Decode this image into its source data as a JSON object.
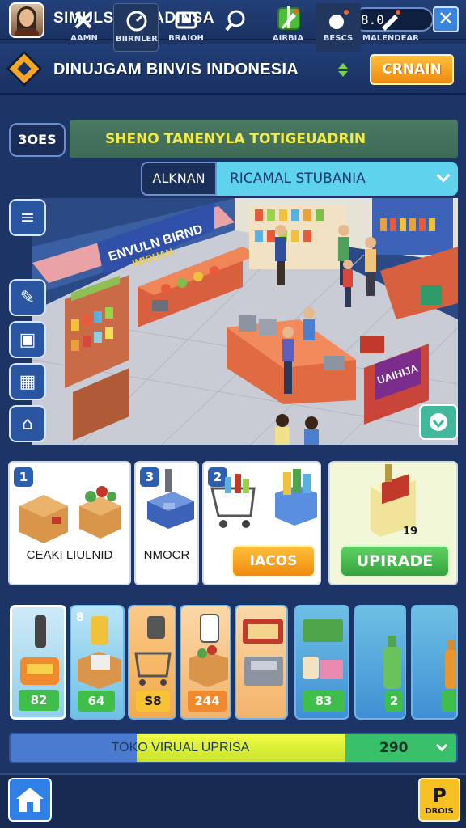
{
  "header": {
    "title": "SIMULSN RUADINSA",
    "currency_label": "8",
    "coins": "8.0"
  },
  "banner": {
    "title": "DINUJGAM BINVIS INDONESIA",
    "button_label": "CRNAIN"
  },
  "filters": {
    "tag": "3OES",
    "select_1": "SHENO TANENYLA TOTIGEUADRIN",
    "select_2_label": "ALKNAN",
    "select_2_value": "RICAMAL STUBANIA"
  },
  "scene": {
    "store_sign": "ENVULN BIRND",
    "store_sign_sub": "IMIOUAN",
    "counter_sign": "UAIHIJA"
  },
  "cards": [
    {
      "badge": "1",
      "label": "CEAKI LIULNID"
    },
    {
      "badge": "3",
      "label": "NMOCR"
    },
    {
      "badge": "2",
      "button": "IACOS"
    },
    {
      "count": "19",
      "button": "UPIRADE"
    }
  ],
  "items": [
    {
      "price": "82",
      "badge": ""
    },
    {
      "price": "64",
      "badge": "8"
    },
    {
      "price": "S8",
      "badge": ""
    },
    {
      "price": "244",
      "badge": ""
    },
    {
      "price": "",
      "badge": ""
    },
    {
      "price": "83",
      "badge": ""
    },
    {
      "price": "2",
      "badge": ""
    },
    {
      "price": "",
      "badge": ""
    }
  ],
  "progress": {
    "label": "TOKO VIRUAL UPRISA",
    "value": "290"
  },
  "nav": [
    {
      "label": "AAMN",
      "icon": "tools-icon"
    },
    {
      "label": "BIIRNLER",
      "icon": "gauge-icon"
    },
    {
      "label": "BRAIOH",
      "icon": "camera-icon"
    },
    {
      "label": "",
      "icon": "search-icon"
    },
    {
      "label": "AIRBIA",
      "icon": "rocket-icon"
    },
    {
      "label": "BESCS",
      "icon": "bomb-icon"
    },
    {
      "label": "MALENDEAR",
      "icon": "wrench-icon"
    },
    {
      "label": "DROIS",
      "icon": "p-icon"
    }
  ],
  "colors": {
    "background": "#1c3566",
    "accent_orange": "#f5a623",
    "upgrade_green": "#3fbf4a",
    "progress_yellow": "#e2f23c"
  }
}
